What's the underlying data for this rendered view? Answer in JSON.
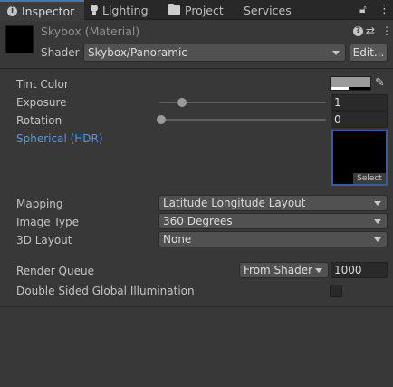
{
  "tabs": [
    {
      "label": "Inspector",
      "icon": "info-icon",
      "active": true
    },
    {
      "label": "Lighting",
      "icon": "lightbulb-icon",
      "active": false
    },
    {
      "label": "Project",
      "icon": "folder-icon",
      "active": false
    },
    {
      "label": "Services",
      "icon": "",
      "active": false
    }
  ],
  "tab_bar_icons": {
    "lock": "🔒",
    "more": "⋮"
  },
  "header": {
    "material_name": "Skybox (Material)",
    "shader_label": "Shader",
    "shader_value": "Skybox/Panoramic",
    "edit_label": "Edit...",
    "help_glyph": "?",
    "settings_glyph": "⇄",
    "more_glyph": "⋮"
  },
  "properties": {
    "tint_color": {
      "label": "Tint Color",
      "color": "#9a9a9a"
    },
    "exposure": {
      "label": "Exposure",
      "value": "1",
      "slider_fraction": 0.125
    },
    "rotation": {
      "label": "Rotation",
      "value": "0",
      "slider_fraction": 0.0
    },
    "spherical": {
      "label": "Spherical  (HDR)",
      "select_label": "Select"
    },
    "mapping": {
      "label": "Mapping",
      "value": "Latitude Longitude Layout"
    },
    "image_type": {
      "label": "Image Type",
      "value": "360 Degrees"
    },
    "layout_3d": {
      "label": "3D Layout",
      "value": "None"
    },
    "render_queue": {
      "label": "Render Queue",
      "mode": "From Shader",
      "value": "1000"
    },
    "double_sided_gi": {
      "label": "Double Sided Global Illumination",
      "checked": false
    }
  },
  "colors": {
    "accent": "#3a79bb",
    "link_label": "#5d93d3",
    "background": "#383838"
  }
}
